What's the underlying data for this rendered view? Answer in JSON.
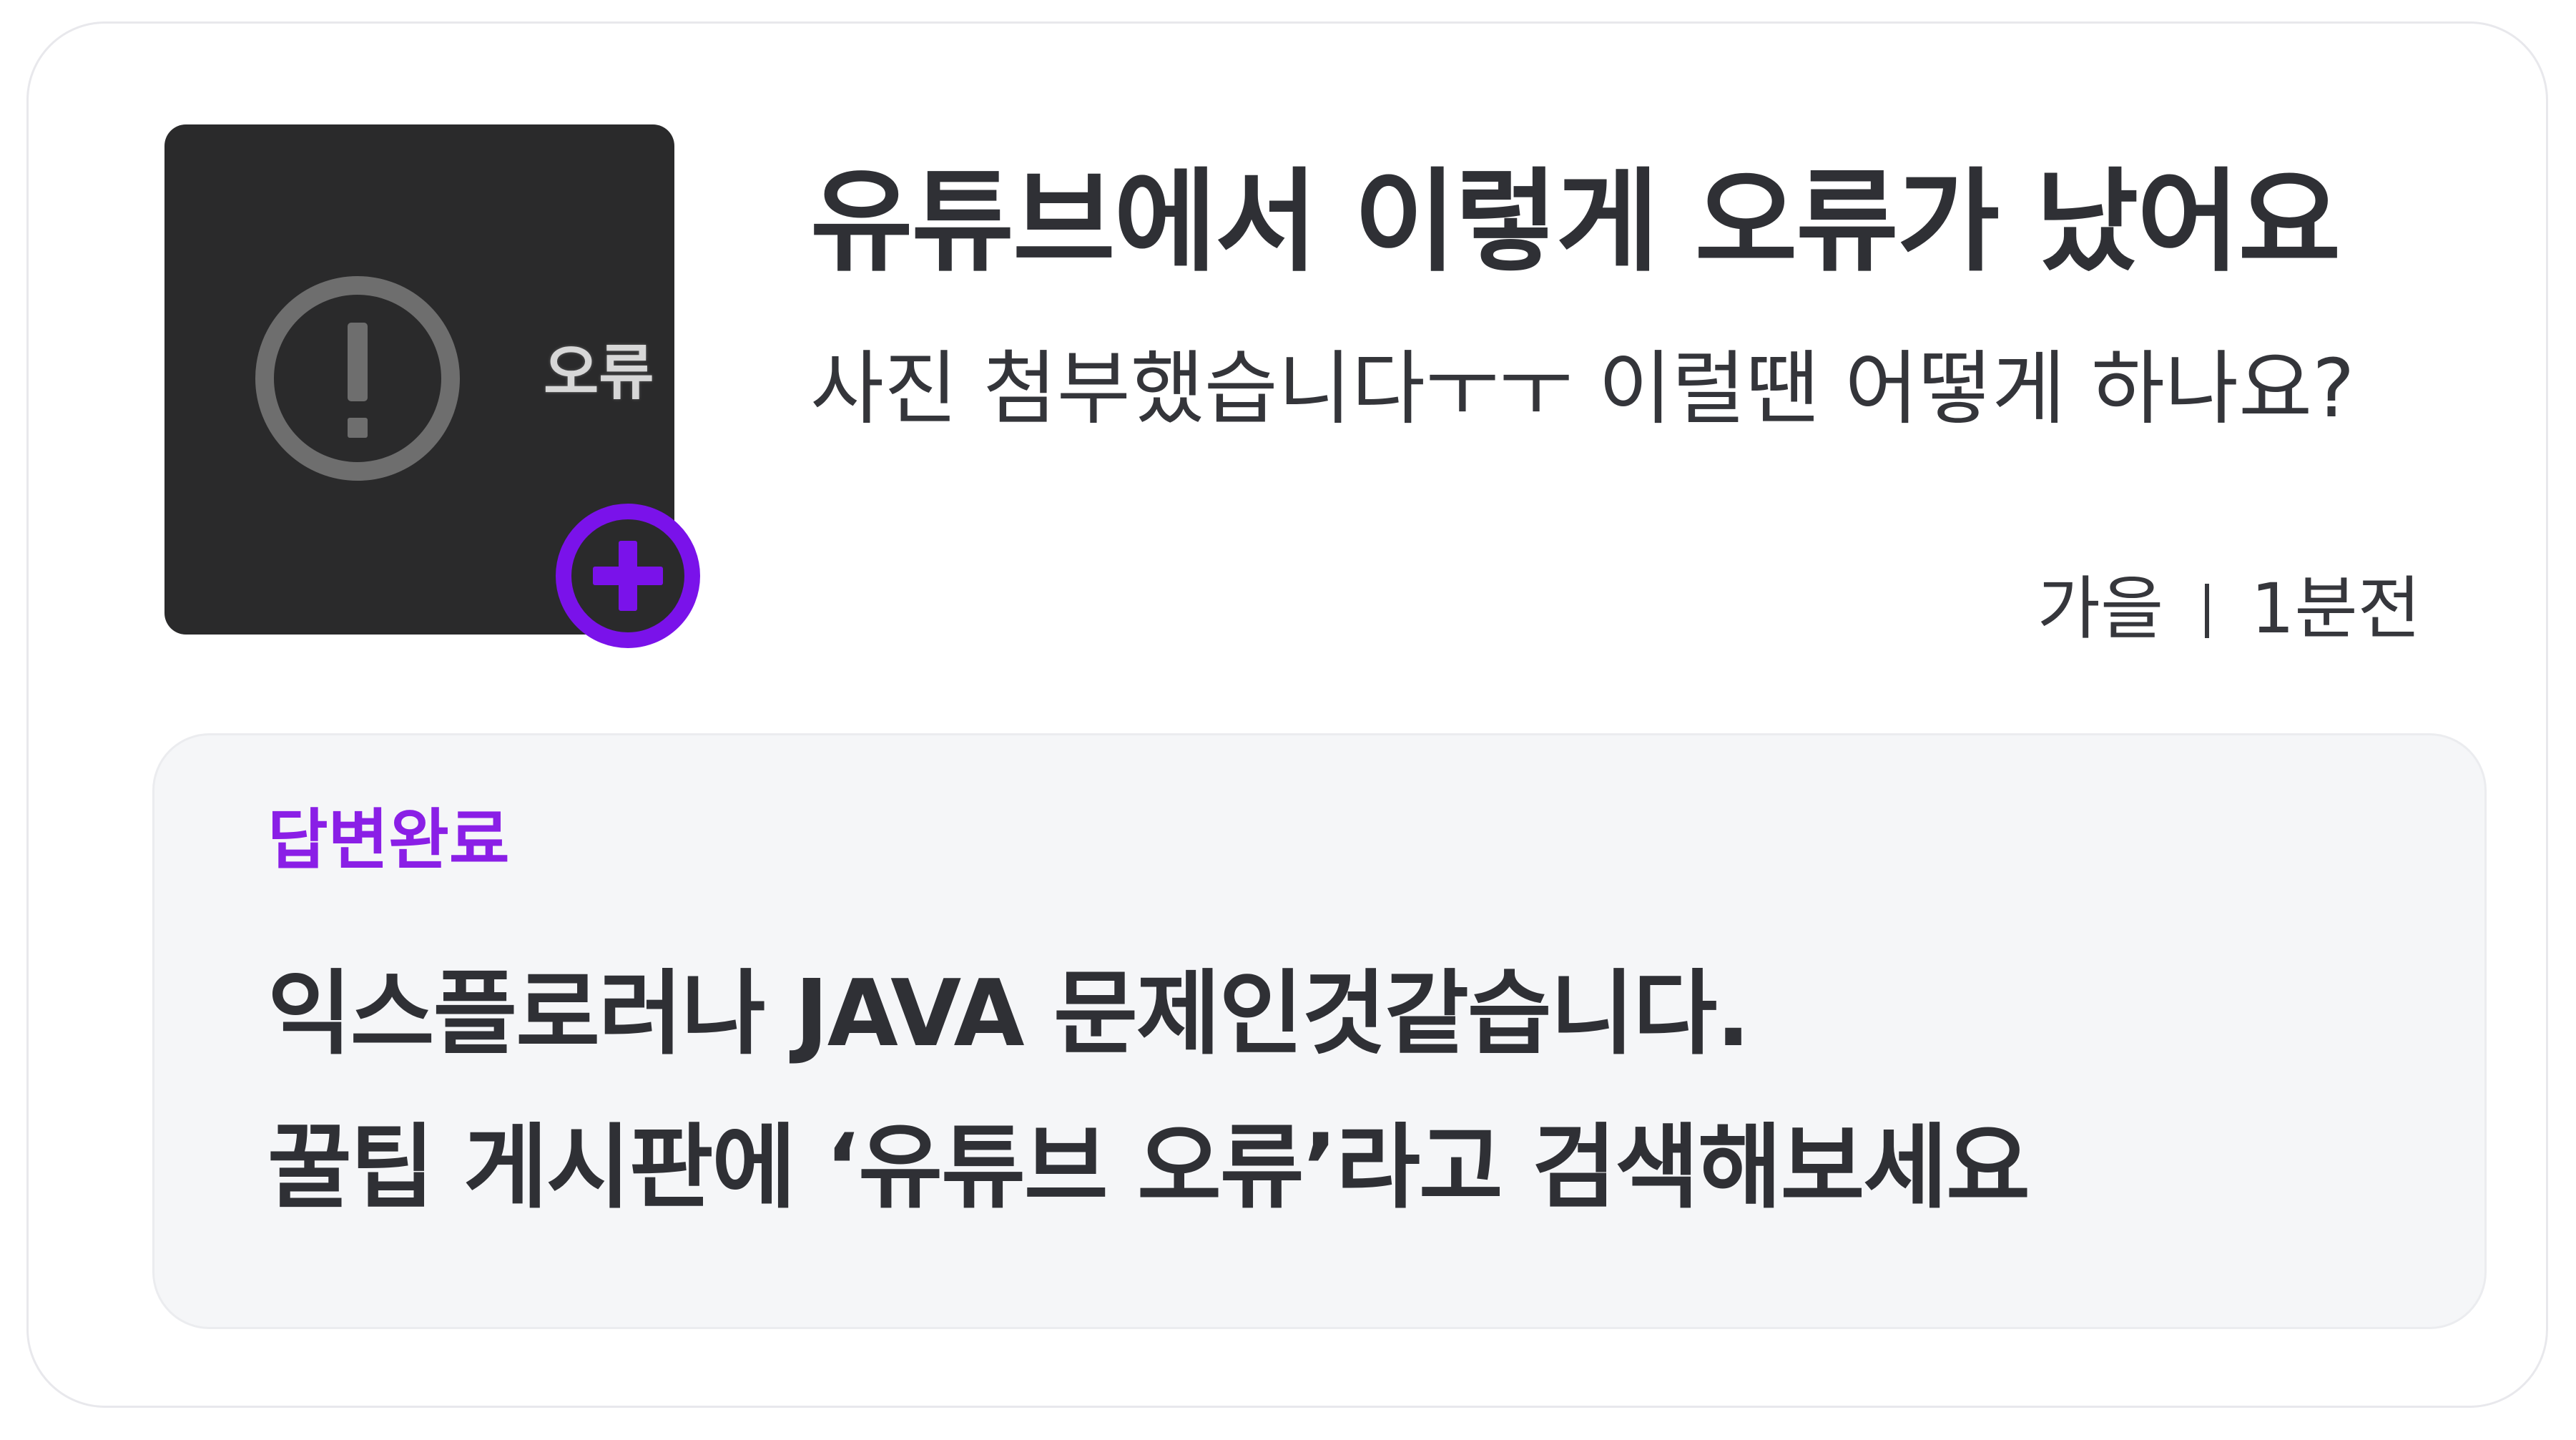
{
  "post": {
    "thumbnail_text": "오류",
    "title": "유튜브에서 이렇게 오류가 났어요",
    "body": "사진 첨부했습니다ㅜㅜ 이럴땐 어떻게 하나요?",
    "author": "가을",
    "time": "1분전"
  },
  "answer": {
    "status": "답변완료",
    "lines": [
      "익스플로러나 JAVA 문제인것같습니다.",
      "꿀팁 게시판에 ‘유튜브 오류’라고 검색해보세요"
    ]
  },
  "icons": {
    "thumbnail": "error-circle-icon",
    "badge": "plus-circle-icon"
  },
  "colors": {
    "accent": "#8a1fe6",
    "text": "#2f3035",
    "answer_bg": "#f5f6f8",
    "thumb_bg": "#2a2a2b"
  }
}
